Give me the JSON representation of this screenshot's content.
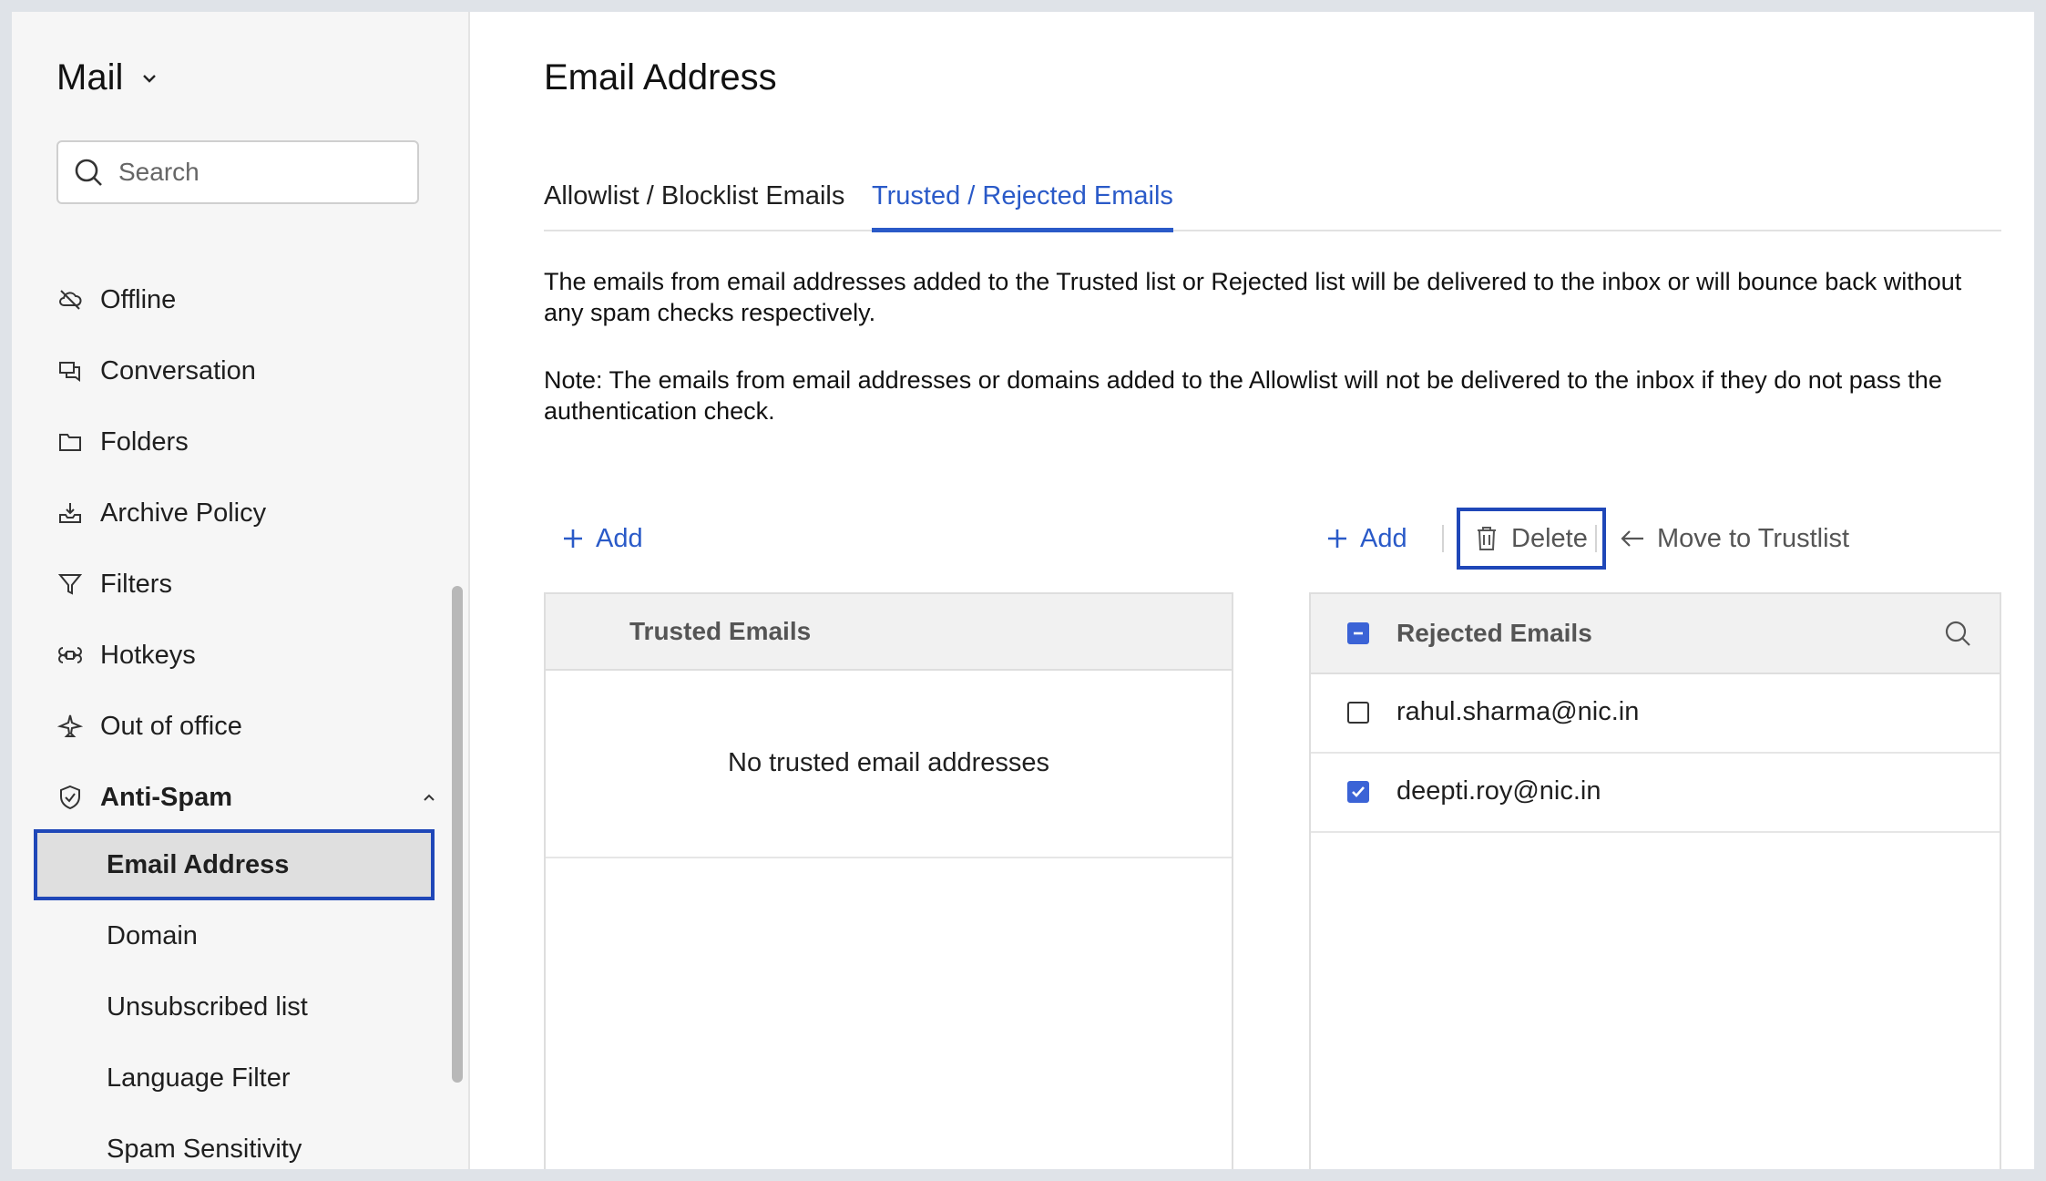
{
  "sidebar": {
    "title": "Mail",
    "search_placeholder": "Search",
    "items": [
      {
        "label": "Offline"
      },
      {
        "label": "Conversation"
      },
      {
        "label": "Folders"
      },
      {
        "label": "Archive Policy"
      },
      {
        "label": "Filters"
      },
      {
        "label": "Hotkeys"
      },
      {
        "label": "Out of office"
      },
      {
        "label": "Anti-Spam"
      }
    ],
    "antispam_sub": [
      {
        "label": "Email Address",
        "active": true
      },
      {
        "label": "Domain"
      },
      {
        "label": "Unsubscribed list"
      },
      {
        "label": "Language Filter"
      },
      {
        "label": "Spam Sensitivity"
      }
    ]
  },
  "main": {
    "title": "Email Address",
    "tabs": [
      {
        "label": "Allowlist / Blocklist Emails"
      },
      {
        "label": "Trusted / Rejected Emails",
        "active": true
      }
    ],
    "description": "The emails from email addresses added to the Trusted list or Rejected list will be delivered to the inbox or will bounce back without any spam checks respectively.",
    "note": "Note: The emails from email addresses or domains added to the Allowlist will not be delivered to the inbox if they do not pass the authentication check.",
    "trusted": {
      "add_label": "Add",
      "header": "Trusted Emails",
      "empty": "No trusted email addresses"
    },
    "rejected": {
      "add_label": "Add",
      "delete_label": "Delete",
      "move_label": "Move to Trustlist",
      "header": "Rejected Emails",
      "rows": [
        {
          "email": "rahul.sharma@nic.in",
          "checked": false
        },
        {
          "email": "deepti.roy@nic.in",
          "checked": true
        }
      ]
    }
  },
  "colors": {
    "accent": "#2a5ac8",
    "highlight_border": "#1f47b8",
    "checkbox": "#3b63d6"
  }
}
